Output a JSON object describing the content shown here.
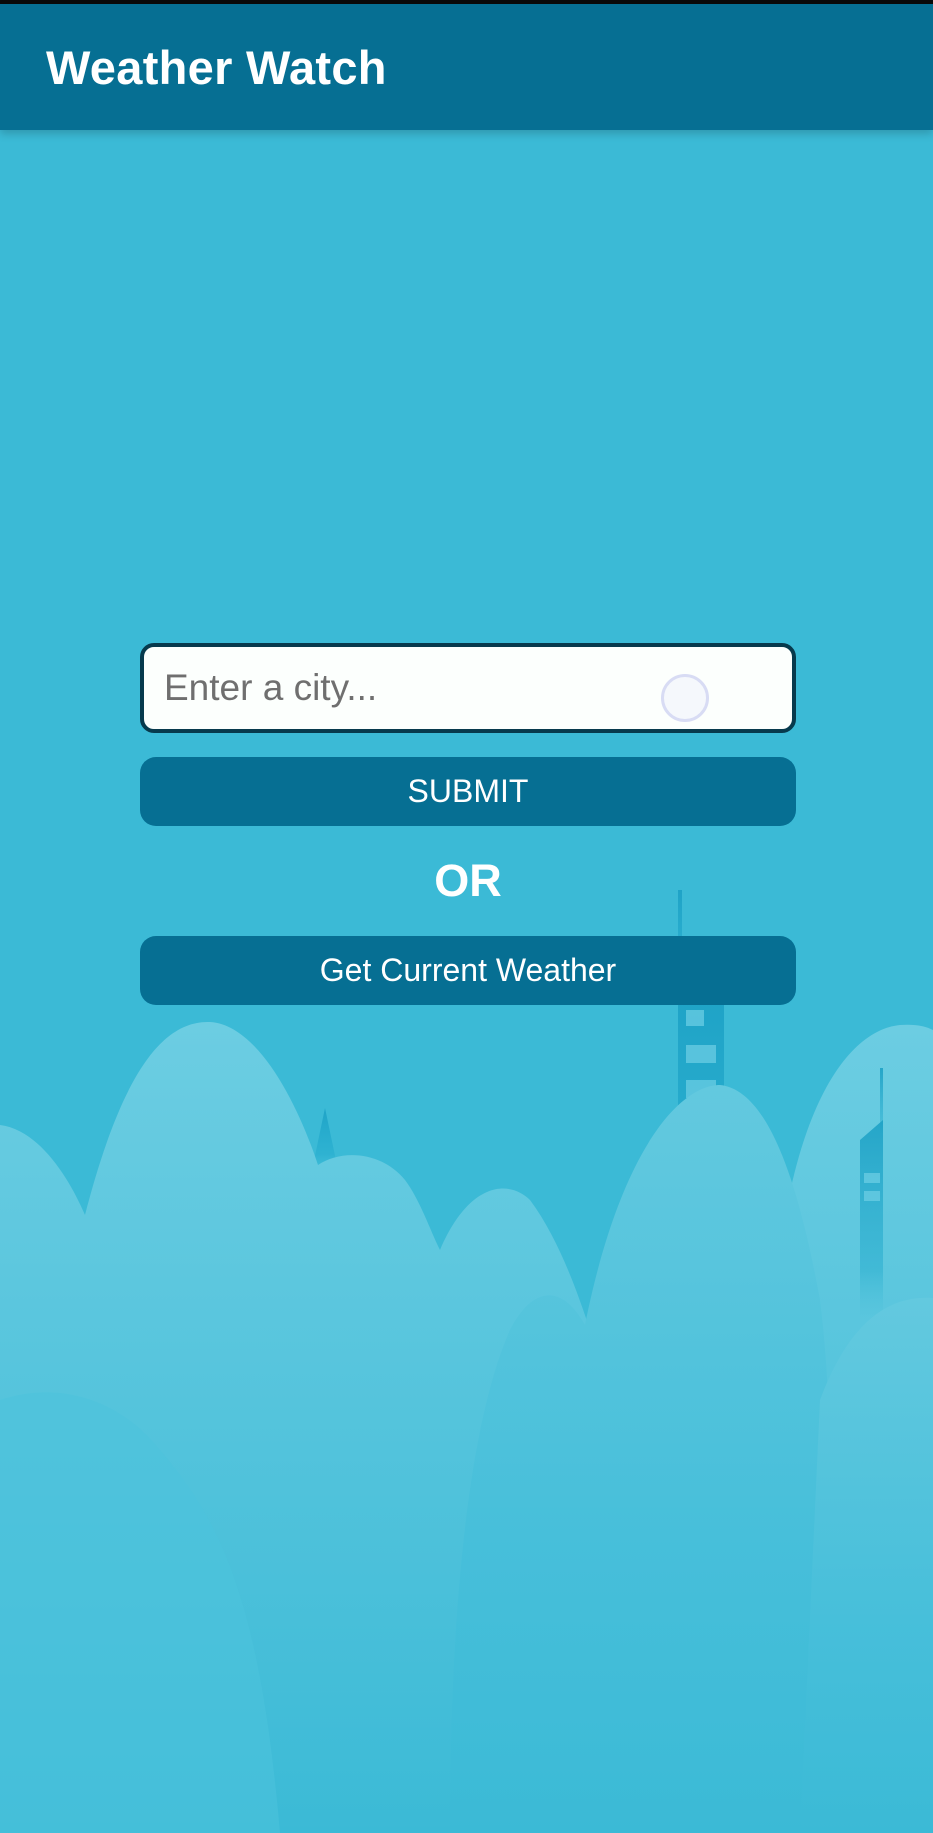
{
  "app_bar": {
    "title": "Weather Watch"
  },
  "search": {
    "placeholder": "Enter a city...",
    "value": ""
  },
  "actions": {
    "submit_label": "SUBMIT",
    "or_label": "OR",
    "current_weather_label": "Get Current Weather"
  },
  "colors": {
    "app_bar": "#066f93",
    "background": "#3bbad6",
    "button": "#066f93",
    "input_border": "#073a4d"
  },
  "icons": {
    "background_art": "city-skyline-illustration"
  }
}
